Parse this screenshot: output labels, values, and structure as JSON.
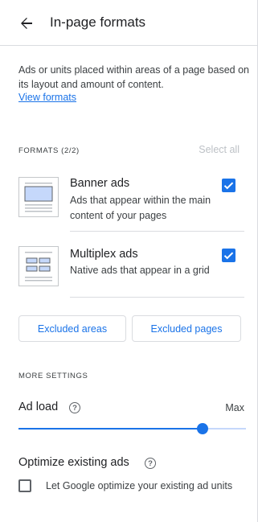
{
  "header": {
    "title": "In-page formats"
  },
  "intro": {
    "description": "Ads or units placed within areas of a page based on its layout and amount of content.",
    "link_label": "View formats"
  },
  "formats": {
    "section_label": "FORMATS (2/2)",
    "select_all_label": "Select all",
    "items": [
      {
        "title": "Banner ads",
        "description": "Ads that appear within the main content of your pages",
        "checked": true
      },
      {
        "title": "Multiplex ads",
        "description": "Native ads that appear in a grid",
        "checked": true
      }
    ]
  },
  "buttons": {
    "excluded_areas": "Excluded areas",
    "excluded_pages": "Excluded pages"
  },
  "more_settings": {
    "section_label": "MORE SETTINGS",
    "ad_load": {
      "label": "Ad load",
      "help_glyph": "?",
      "max_label": "Max",
      "level": 0.81
    },
    "optimize": {
      "title": "Optimize existing ads",
      "help_glyph": "?",
      "checkbox_label": "Let Google optimize your existing ad units",
      "checked": false
    }
  },
  "colors": {
    "accent": "#1a73e8",
    "track": "#c5d8fb",
    "border": "#dadce0",
    "text": "#202124"
  },
  "icons": {
    "back": "arrow-left-icon",
    "check": "checkmark-icon",
    "help": "help-circle-icon"
  }
}
